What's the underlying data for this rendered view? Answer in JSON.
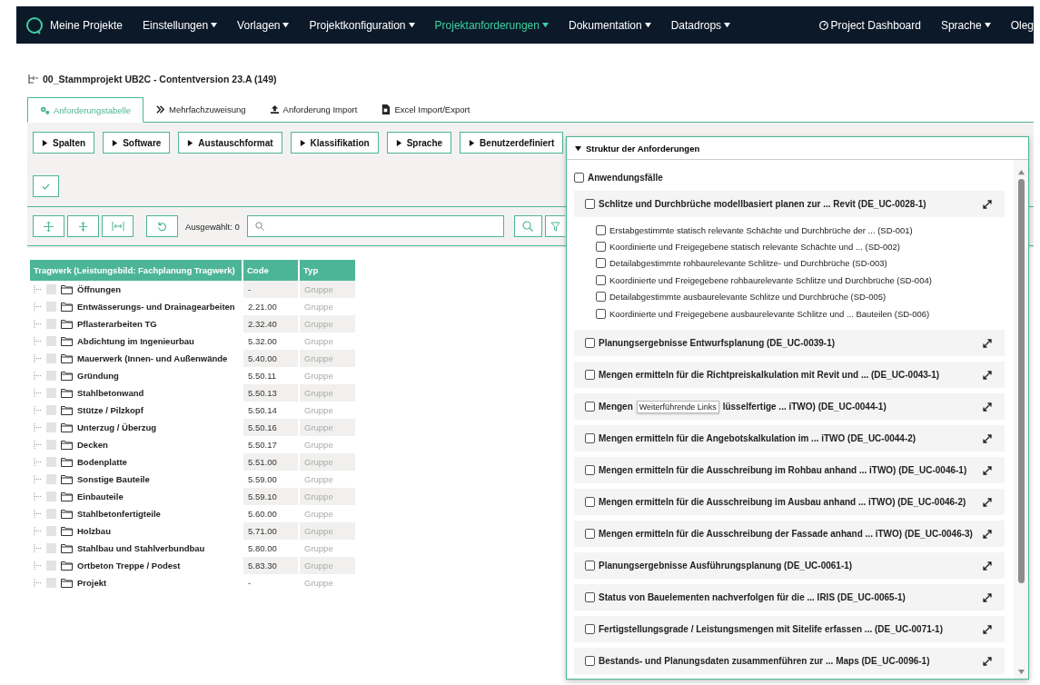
{
  "navbar": {
    "brand": "Meine Projekte",
    "menus": [
      {
        "label": "Einstellungen",
        "selected": false
      },
      {
        "label": "Vorlagen",
        "selected": false
      },
      {
        "label": "Projektkonfiguration",
        "selected": false
      },
      {
        "label": "Projektanforderungen",
        "selected": true
      },
      {
        "label": "Dokumentation",
        "selected": false
      },
      {
        "label": "Datadrops",
        "selected": false
      }
    ],
    "dashboard": "Project Dashboard",
    "language": "Sprache",
    "user": "Oleg"
  },
  "project_title": "00_Stammprojekt UB2C - Contentversion 23.A (149)",
  "tabs": [
    {
      "label": "Anforderungstabelle",
      "selected": true,
      "kind": "gears"
    },
    {
      "label": "Mehrfachzuweisung",
      "selected": false,
      "kind": "chevrons"
    },
    {
      "label": "Anforderung Import",
      "selected": false,
      "kind": "upload"
    },
    {
      "label": "Excel Import/Export",
      "selected": false,
      "kind": "file"
    }
  ],
  "filter_buttons": [
    "Spalten",
    "Software",
    "Austauschformat",
    "Klassifikation",
    "Sprache",
    "Benutzerdefiniert"
  ],
  "toolbar": {
    "selected_count": "Ausgewählt: 0"
  },
  "table": {
    "columns": [
      "Tragwerk (Leistungsbild: Fachplanung Tragwerk)",
      "Code",
      "Typ"
    ],
    "rows": [
      {
        "name": "Öffnungen",
        "code": "-",
        "type": "Gruppe",
        "checked": false
      },
      {
        "name": "Entwässerungs- und Drainagearbeiten",
        "code": "2.21.00",
        "type": "Gruppe",
        "checked": false
      },
      {
        "name": "Pflasterarbeiten TG",
        "code": "2.32.40",
        "type": "Gruppe",
        "checked": false
      },
      {
        "name": "Abdichtung im Ingenieurbau",
        "code": "5.32.00",
        "type": "Gruppe",
        "checked": false
      },
      {
        "name": "Mauerwerk (Innen- und Außenwände",
        "code": "5.40.00",
        "type": "Gruppe",
        "checked": false
      },
      {
        "name": "Gründung",
        "code": "5.50.11",
        "type": "Gruppe",
        "checked": false
      },
      {
        "name": "Stahlbetonwand",
        "code": "5.50.13",
        "type": "Gruppe",
        "checked": false
      },
      {
        "name": "Stütze / Pilzkopf",
        "code": "5.50.14",
        "type": "Gruppe",
        "checked": false
      },
      {
        "name": "Unterzug / Überzug",
        "code": "5.50.16",
        "type": "Gruppe",
        "checked": false
      },
      {
        "name": "Decken",
        "code": "5.50.17",
        "type": "Gruppe",
        "checked": false
      },
      {
        "name": "Bodenplatte",
        "code": "5.51.00",
        "type": "Gruppe",
        "checked": false
      },
      {
        "name": "Sonstige Bauteile",
        "code": "5.59.00",
        "type": "Gruppe",
        "checked": false
      },
      {
        "name": "Einbauteile",
        "code": "5.59.10",
        "type": "Gruppe",
        "checked": false
      },
      {
        "name": "Stahlbetonfertigteile",
        "code": "5.60.00",
        "type": "Gruppe",
        "checked": false
      },
      {
        "name": "Holzbau",
        "code": "5.71.00",
        "type": "Gruppe",
        "checked": false
      },
      {
        "name": "Stahlbau und Stahlverbundbau",
        "code": "5.80.00",
        "type": "Gruppe",
        "checked": false
      },
      {
        "name": "Ortbeton Treppe / Podest",
        "code": "5.83.30",
        "type": "Gruppe",
        "checked": false
      },
      {
        "name": "Projekt",
        "code": "-",
        "type": "Gruppe",
        "checked": false
      }
    ]
  },
  "structure_panel": {
    "title": "Struktur der Anforderungen",
    "expanded": true,
    "root": {
      "label": "Anwendungsfälle",
      "checked": false
    },
    "groups": [
      {
        "label": "Schlitze und Durchbrüche modellbasiert planen zur ... Revit (DE_UC-0028-1)",
        "checked": false,
        "expanded": true,
        "children": [
          {
            "label": "Erstabgestimmte statisch relevante Schächte und Durchbrüche der ... (SD-001)",
            "checked": false
          },
          {
            "label": "Koordinierte und Freigegebene statisch relevante Schächte und ... (SD-002)",
            "checked": false
          },
          {
            "label": "Detailabgestimmte rohbaurelevante Schlitze- und Durchbrüche (SD-003)",
            "checked": false
          },
          {
            "label": "Koordinierte und Freigegebene rohbaurelevante Schlitze und Durchbrüche (SD-004)",
            "checked": false
          },
          {
            "label": "Detailabgestimmte ausbaurelevante Schlitze und Durchbrüche (SD-005)",
            "checked": false
          },
          {
            "label": "Koordinierte und Freigegebene ausbaurelevante Schlitze und ... Bauteilen (SD-006)",
            "checked": false
          }
        ]
      },
      {
        "label": "Planungsergebnisse Entwurfsplanung (DE_UC-0039-1)",
        "checked": false
      },
      {
        "label": "Mengen ermitteln für die Richtpreiskalkulation mit Revit und ... (DE_UC-0043-1)",
        "checked": false
      },
      {
        "label": "Mengen",
        "label_rest": "lüsselfertige ... iTWO) (DE_UC-0044-1)",
        "tooltip": "Weiterführende Links",
        "checked": false
      },
      {
        "label": "Mengen ermitteln für die Angebotskalkulation im ... iTWO (DE_UC-0044-2)",
        "checked": false
      },
      {
        "label": "Mengen ermitteln für die Ausschreibung im Rohbau anhand ... iTWO) (DE_UC-0046-1)",
        "checked": false
      },
      {
        "label": "Mengen ermitteln für die Ausschreibung im Ausbau anhand ... iTWO) (DE_UC-0046-2)",
        "checked": false
      },
      {
        "label": "Mengen ermitteln für die Ausschreibung der Fassade anhand ... iTWO) (DE_UC-0046-3)",
        "checked": false
      },
      {
        "label": "Planungsergebnisse Ausführungsplanung (DE_UC-0061-1)",
        "checked": false
      },
      {
        "label": "Status von Bauelementen nachverfolgen für die ... IRIS (DE_UC-0065-1)",
        "checked": false
      },
      {
        "label": "Fertigstellungsgrade / Leistungsmengen mit Sitelife erfassen ... (DE_UC-0071-1)",
        "checked": false
      },
      {
        "label": "Bestands- und Planungsdaten zusammenführen zur ... Maps (DE_UC-0096-1)",
        "checked": false
      }
    ]
  }
}
